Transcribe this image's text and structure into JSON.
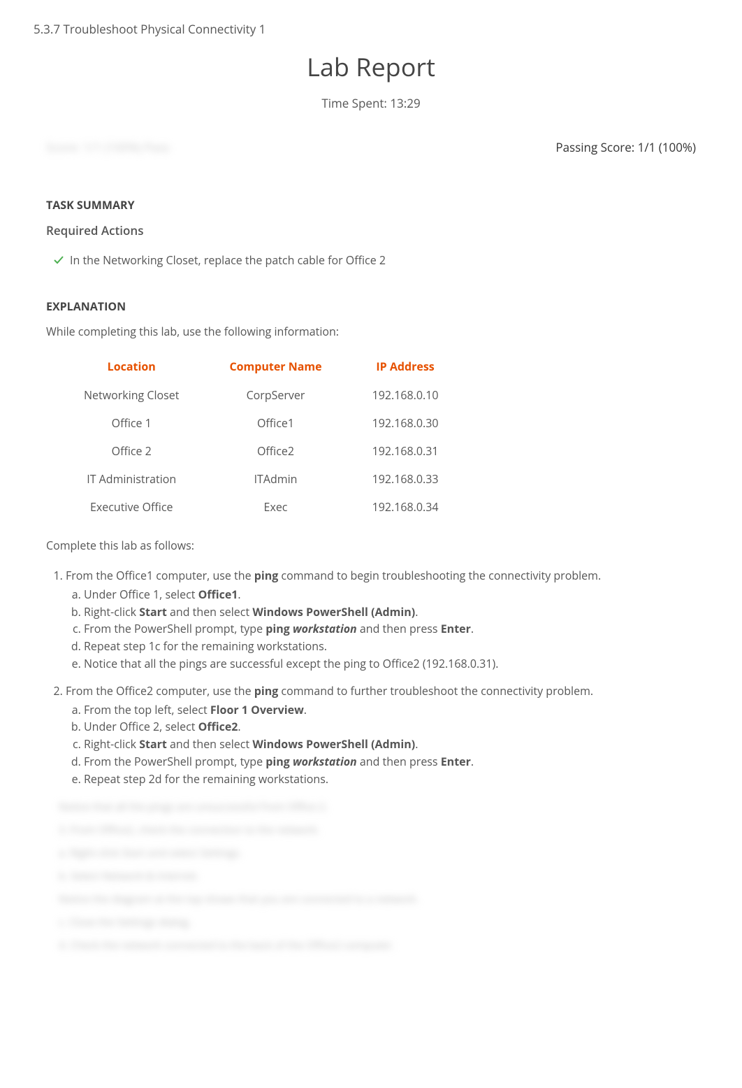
{
  "page": {
    "title": "5.3.7 Troubleshoot Physical Connectivity 1",
    "heading": "Lab Report",
    "timeSpentLabel": "Time Spent: 13:29",
    "scoreLeft": "Score: 1/1 (100%) Pass",
    "passingScore": "Passing Score: 1/1 (100%)"
  },
  "taskSummary": {
    "heading": "TASK SUMMARY",
    "requiredActionsHeading": "Required Actions",
    "action1": "In the Networking Closet, replace the patch cable for Office 2"
  },
  "explanation": {
    "heading": "EXPLANATION",
    "intro": "While completing this lab, use the following information:",
    "tableHeaders": {
      "location": "Location",
      "computerName": "Computer Name",
      "ipAddress": "IP Address"
    },
    "tableRows": [
      {
        "location": "Networking Closet",
        "computerName": "CorpServer",
        "ipAddress": "192.168.0.10"
      },
      {
        "location": "Office 1",
        "computerName": "Office1",
        "ipAddress": "192.168.0.30"
      },
      {
        "location": "Office 2",
        "computerName": "Office2",
        "ipAddress": "192.168.0.31"
      },
      {
        "location": "IT Administration",
        "computerName": "ITAdmin",
        "ipAddress": "192.168.0.33"
      },
      {
        "location": "Executive Office",
        "computerName": "Exec",
        "ipAddress": "192.168.0.34"
      }
    ],
    "completeText": "Complete this lab as follows:",
    "steps": [
      {
        "intro_p1": "From the Office1 computer, use the ",
        "bold1": "ping",
        "intro_p2": " command to begin troubleshooting the connectivity problem.",
        "sub": [
          {
            "t1": "Under Office 1, select ",
            "b1": "Office1",
            "t2": "."
          },
          {
            "t1": "Right-click ",
            "b1": "Start",
            "t2": " and then select ",
            "b2": "Windows PowerShell (Admin)",
            "t3": "."
          },
          {
            "t1": "From the PowerShell prompt, type ",
            "b1": "ping ",
            "bi1": "workstation",
            "t2": " and then press ",
            "b2": "Enter",
            "t3": "."
          },
          {
            "t1": "Repeat step 1c for the remaining workstations."
          },
          {
            "t1": "Notice that all the pings are successful except the ping to Office2 (192.168.0.31)."
          }
        ]
      },
      {
        "intro_p1": "From the Office2 computer, use the ",
        "bold1": "ping",
        "intro_p2": " command to further troubleshoot the connectivity problem.",
        "sub": [
          {
            "t1": "From the top left, select ",
            "b1": "Floor 1 Overview",
            "t2": "."
          },
          {
            "t1": "Under Office 2, select ",
            "b1": "Office2",
            "t2": "."
          },
          {
            "t1": "Right-click ",
            "b1": "Start",
            "t2": " and then select ",
            "b2": "Windows PowerShell (Admin)",
            "t3": "."
          },
          {
            "t1": "From the PowerShell prompt, type ",
            "b1": "ping ",
            "bi1": "workstation",
            "t2": " and then press ",
            "b2": "Enter",
            "t3": "."
          },
          {
            "t1": "Repeat step 2d for the remaining workstations."
          }
        ]
      }
    ]
  },
  "blurred": {
    "l1": "Notice that all the pings are unsuccessful from Office 2.",
    "l2": "3. From Office2, check the connection to the network.",
    "l3": "a. Right-click Start and select Settings.",
    "l4": "b. Select Network & Internet.",
    "l5": "Notice the diagram at the top shows that you are connected to a network.",
    "l6": "c. Close the Settings dialog.",
    "l7": "4. Check the network connected to the back of the Office2 computer."
  }
}
